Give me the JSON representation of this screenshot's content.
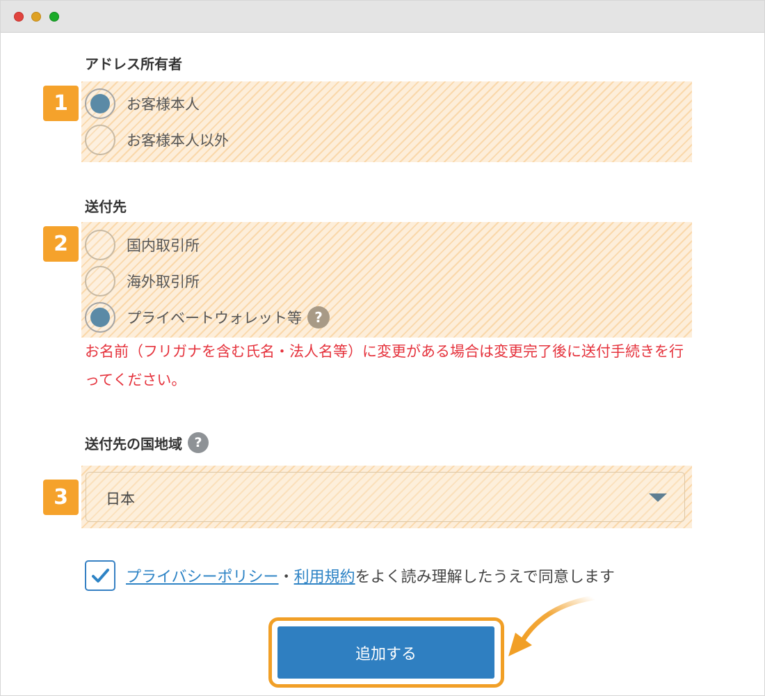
{
  "owner_section": {
    "title": "アドレス所有者",
    "badge": "1",
    "options": [
      {
        "label": "お客様本人",
        "checked": true
      },
      {
        "label": "お客様本人以外",
        "checked": false
      }
    ]
  },
  "destination_section": {
    "title": "送付先",
    "badge": "2",
    "options": [
      {
        "label": "国内取引所",
        "checked": false
      },
      {
        "label": "海外取引所",
        "checked": false
      },
      {
        "label": "プライベートウォレット等",
        "checked": true
      }
    ],
    "help_symbol": "?",
    "warning": "お名前（フリガナを含む氏名・法人名等）に変更がある場合は変更完了後に送付手続きを行ってください。"
  },
  "country_section": {
    "title": "送付先の国地域",
    "help_symbol": "?",
    "badge": "3",
    "selected": "日本"
  },
  "agreement": {
    "checked": true,
    "privacy_link": "プライバシーポリシー",
    "separator": "・",
    "terms_link": "利用規約",
    "text": "をよく読み理解したうえで同意します"
  },
  "submit_label": "追加する",
  "colors": {
    "accent_orange": "#f5a22b",
    "button_blue": "#2f7fc1",
    "warning_red": "#e5323c",
    "link_blue": "#2d83c5"
  }
}
